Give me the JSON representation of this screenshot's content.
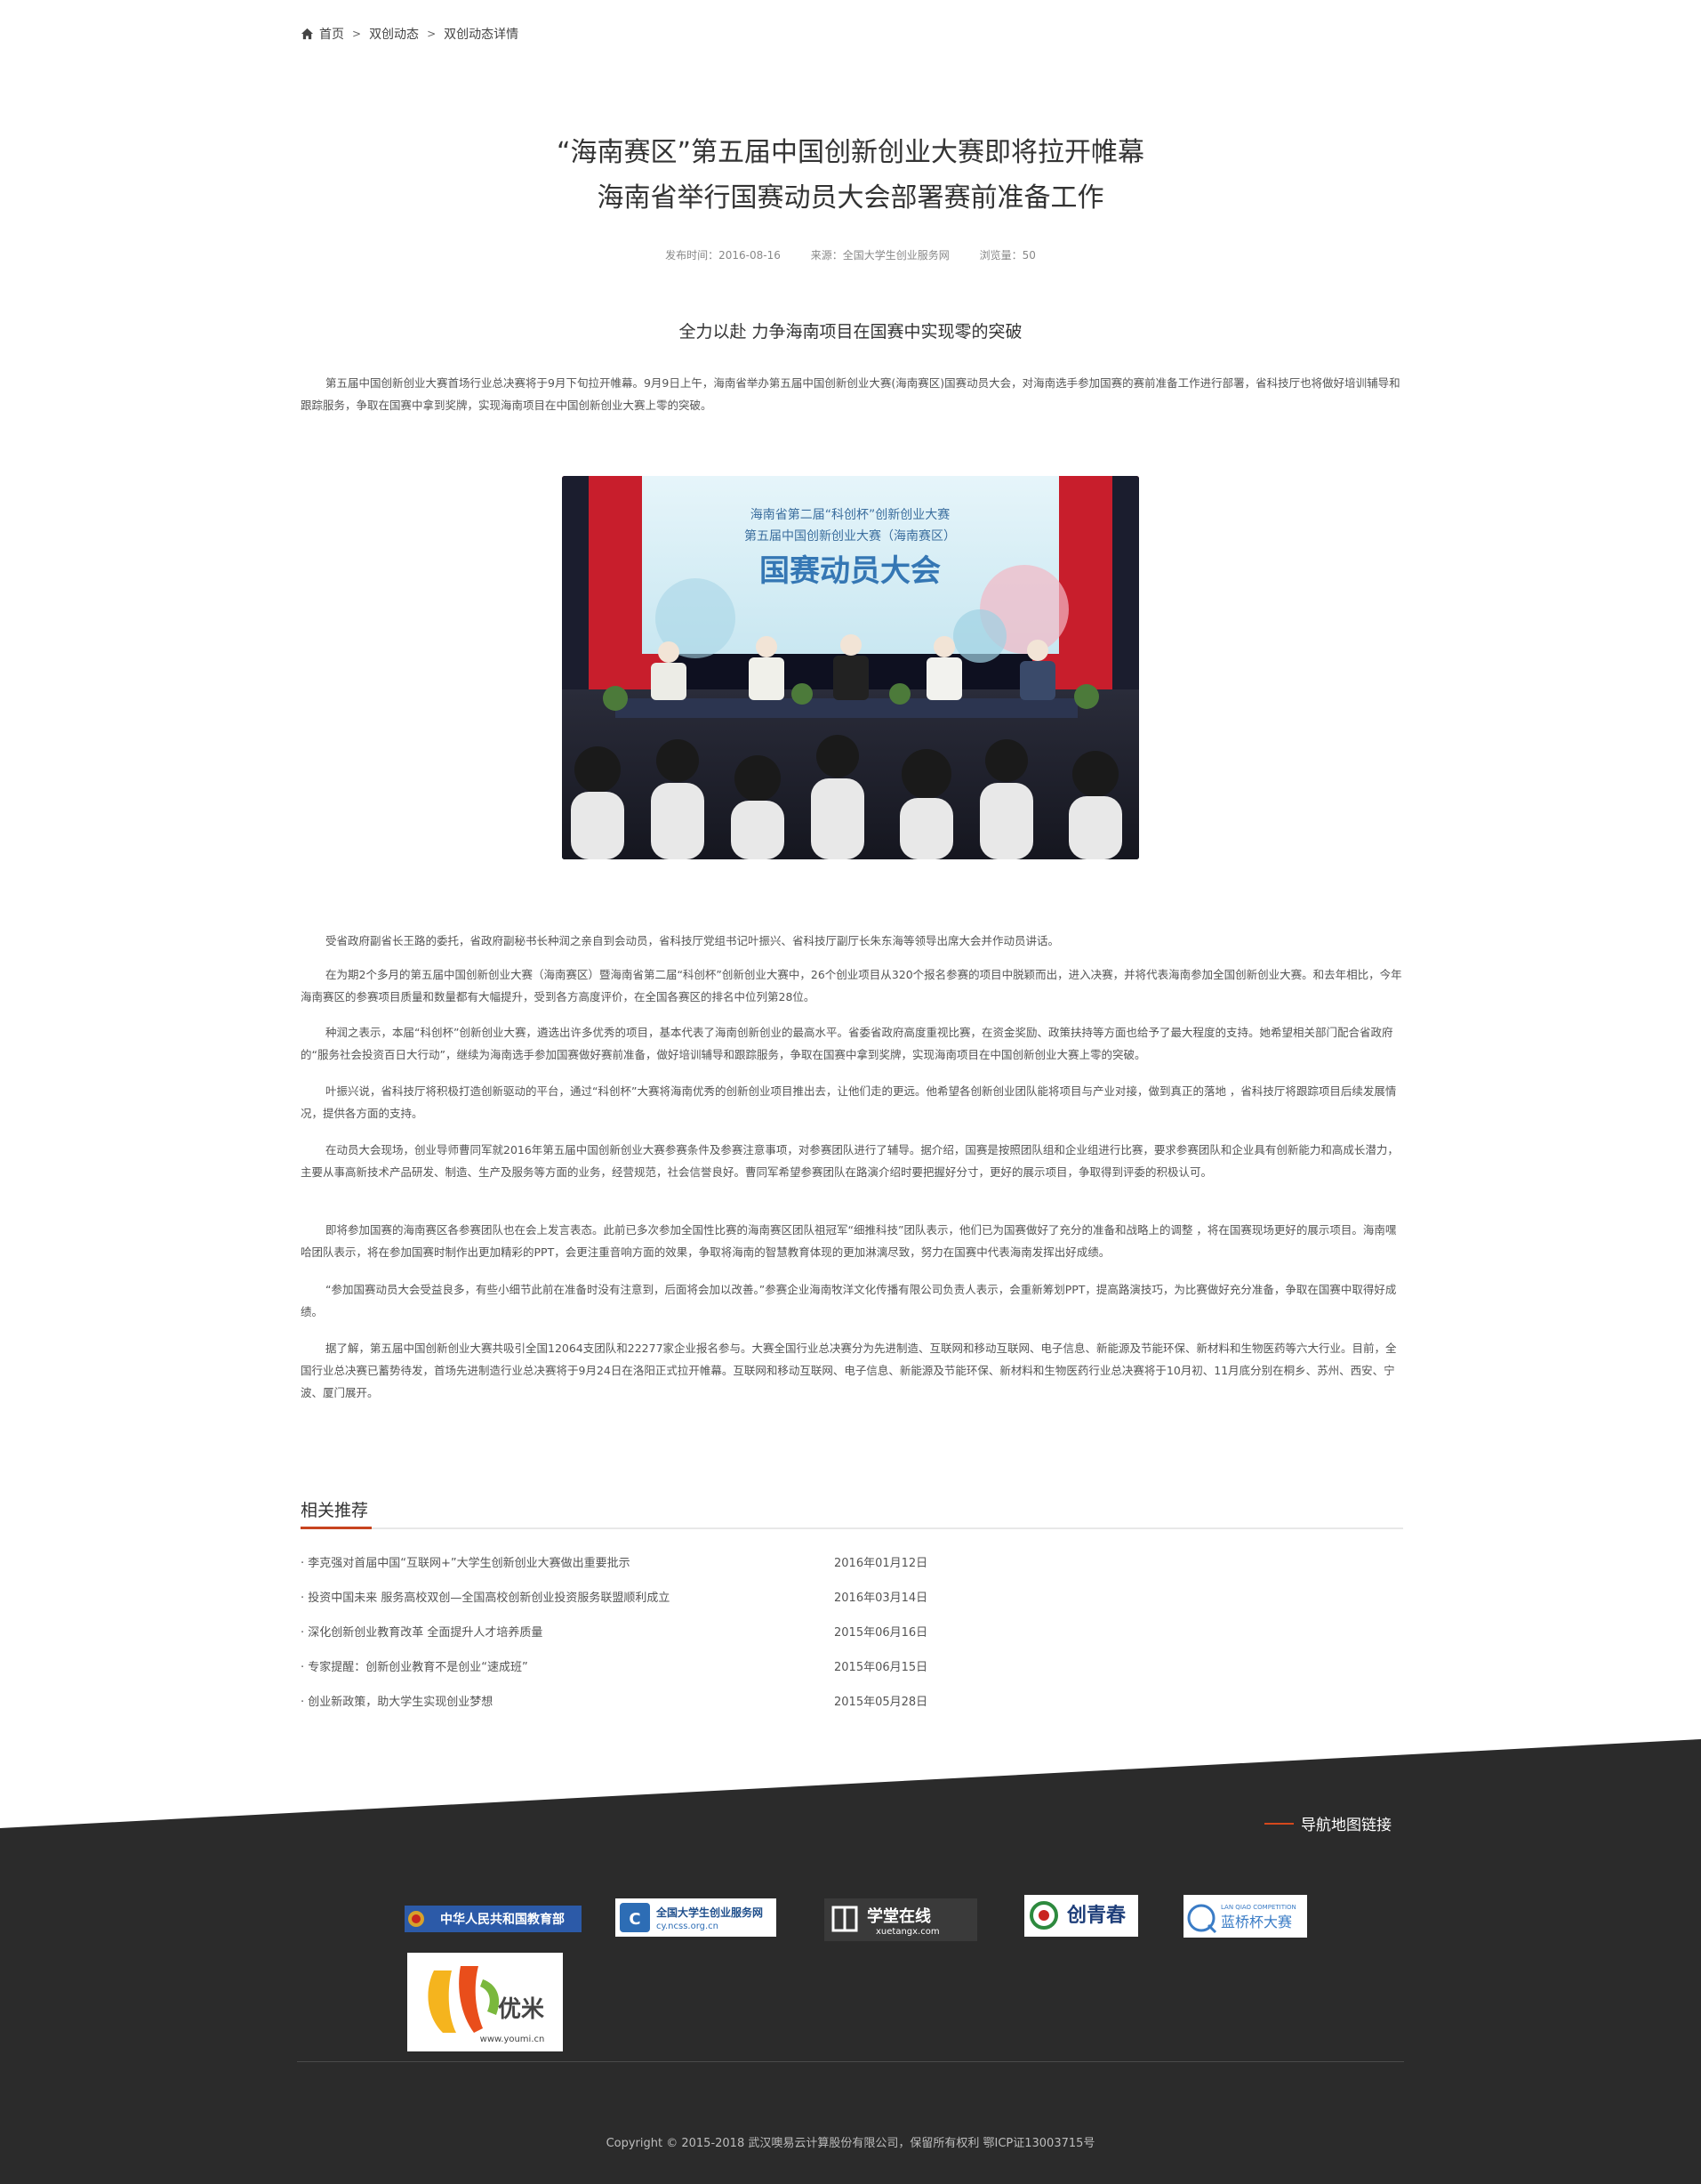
{
  "breadcrumb": {
    "home": "首页",
    "sep": ">",
    "level1": "双创动态",
    "level2": "双创动态详情"
  },
  "article": {
    "title_line1": "“海南赛区”第五届中国创新创业大赛即将拉开帷幕",
    "title_line2": "海南省举行国赛动员大会部署赛前准备工作",
    "publish_time": "发布时间：2016-08-16",
    "source": "来源：全国大学生创业服务网",
    "views": "浏览量：50",
    "subtitle": "全力以赴 力争海南项目在国赛中实现零的突破",
    "intro": "第五届中国创新创业大赛首场行业总决赛将于9月下旬拉开帷幕。9月9日上午，海南省举办第五届中国创新创业大赛(海南赛区)国赛动员大会，对海南选手参加国赛的赛前准备工作进行部署，省科技厅也将做好培训辅导和跟踪服务，争取在国赛中拿到奖牌，实现海南项目在中国创新创业大赛上零的突破。",
    "photo": {
      "banner_line1": "海南省第二届“科创杯”创新创业大赛",
      "banner_line2": "第五届中国创新创业大赛（海南赛区）",
      "banner_title": "国赛动员大会"
    },
    "paragraphs": [
      "受省政府副省长王路的委托，省政府副秘书长种润之亲自到会动员，省科技厅党组书记叶振兴、省科技厅副厅长朱东海等领导出席大会并作动员讲话。",
      "在为期2个多月的第五届中国创新创业大赛（海南赛区）暨海南省第二届“科创杯”创新创业大赛中，26个创业项目从320个报名参赛的项目中脱颖而出，进入决赛，并将代表海南参加全国创新创业大赛。和去年相比，今年海南赛区的参赛项目质量和数量都有大幅提升，受到各方高度评价，在全国各赛区的排名中位列第28位。",
      "种润之表示，本届“科创杯”创新创业大赛，遴选出许多优秀的项目，基本代表了海南创新创业的最高水平。省委省政府高度重视比赛，在资金奖励、政策扶持等方面也给予了最大程度的支持。她希望相关部门配合省政府的“服务社会投资百日大行动”，继续为海南选手参加国赛做好赛前准备，做好培训辅导和跟踪服务，争取在国赛中拿到奖牌，实现海南项目在中国创新创业大赛上零的突破。",
      "叶振兴说，省科技厅将积极打造创新驱动的平台，通过“科创杯”大赛将海南优秀的创新创业项目推出去，让他们走的更远。他希望各创新创业团队能将项目与产业对接，做到真正的落地 ，省科技厅将跟踪项目后续发展情况，提供各方面的支持。",
      "在动员大会现场，创业导师曹同军就2016年第五届中国创新创业大赛参赛条件及参赛注意事项，对参赛团队进行了辅导。据介绍，国赛是按照团队组和企业组进行比赛，要求参赛团队和企业具有创新能力和高成长潜力，主要从事高新技术产品研发、制造、生产及服务等方面的业务，经营规范，社会信誉良好。曹同军希望参赛团队在路演介绍时要把握好分寸，更好的展示项目，争取得到评委的积极认可。",
      "即将参加国赛的海南赛区各参赛团队也在会上发言表态。此前已多次参加全国性比赛的海南赛区团队祖冠军“细推科技”团队表示，他们已为国赛做好了充分的准备和战略上的调整 ，将在国赛现场更好的展示项目。海南嘿哈团队表示，将在参加国赛时制作出更加精彩的PPT，会更注重音响方面的效果，争取将海南的智慧教育体现的更加淋漓尽致，努力在国赛中代表海南发挥出好成绩。",
      " “参加国赛动员大会受益良多，有些小细节此前在准备时没有注意到，后面将会加以改善。”参赛企业海南牧洋文化传播有限公司负责人表示，会重新筹划PPT，提高路演技巧，为比赛做好充分准备，争取在国赛中取得好成绩。",
      "据了解，第五届中国创新创业大赛共吸引全国12064支团队和22277家企业报名参与。大赛全国行业总决赛分为先进制造、互联网和移动互联网、电子信息、新能源及节能环保、新材料和生物医药等六大行业。目前，全国行业总决赛已蓄势待发，首场先进制造行业总决赛将于9月24日在洛阳正式拉开帷幕。互联网和移动互联网、电子信息、新能源及节能环保、新材料和生物医药行业总决赛将于10月初、11月底分别在桐乡、苏州、西安、宁波、厦门展开。"
    ]
  },
  "related": {
    "heading": "相关推荐",
    "items": [
      {
        "title": "· 李克强对首届中国“互联网+”大学生创新创业大赛做出重要批示",
        "date": "2016年01月12日"
      },
      {
        "title": "· 投资中国未来 服务高校双创—全国高校创新创业投资服务联盟顺利成立",
        "date": "2016年03月14日"
      },
      {
        "title": "· 深化创新创业教育改革 全面提升人才培养质量",
        "date": "2015年06月16日"
      },
      {
        "title": "· 专家提醒：创新创业教育不是创业“速成班”",
        "date": "2015年06月15日"
      },
      {
        "title": "· 创业新政策，助大学生实现创业梦想",
        "date": "2015年05月28日"
      }
    ]
  },
  "footer": {
    "nav_link": "导航地图链接",
    "logos": {
      "moe": "中华人民共和国教育部",
      "ncss_name": "全国大学生创业服务网",
      "ncss_url": "cy.ncss.org.cn",
      "xuetang": "学堂在线",
      "xuetang_url": "xuetangx.com",
      "qingchun": "创青春",
      "lanqiao_en": "LAN QIAO COMPETITION",
      "lanqiao": "蓝桥杯大赛",
      "youmi": "优米",
      "youmi_url": "www.youmi.cn"
    },
    "copyright": "Copyright © 2015-2018 武汉噢易云计算股份有限公司，保留所有权利 鄂ICP证13003715号"
  },
  "colors": {
    "accent": "#c8441f",
    "footer_bg": "#2b2b2b",
    "nav_dash": "#d4481c"
  }
}
